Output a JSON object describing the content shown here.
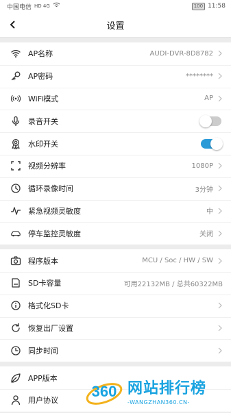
{
  "status_bar": {
    "carrier": "中国电信",
    "network": "HD 4G",
    "battery": "100",
    "time": "11:58"
  },
  "header": {
    "title": "设置"
  },
  "group1": [
    {
      "icon": "wifi-icon",
      "label": "AP名称",
      "value": "AUDI-DVR-8D8782",
      "chevron": true
    },
    {
      "icon": "key-icon",
      "label": "AP密码",
      "value": "********",
      "chevron": true
    },
    {
      "icon": "signal-icon",
      "label": "WiFi模式",
      "value": "AP",
      "chevron": true
    },
    {
      "icon": "microphone-icon",
      "label": "录音开关",
      "toggle": false
    },
    {
      "icon": "award-icon",
      "label": "水印开关",
      "toggle": true
    },
    {
      "icon": "frame-icon",
      "label": "视频分辨率",
      "value": "1080P",
      "chevron": true
    },
    {
      "icon": "clock-icon",
      "label": "循环录像时间",
      "value": "3分钟",
      "chevron": true
    },
    {
      "icon": "pulse-icon",
      "label": "紧急视频灵敏度",
      "value": "中",
      "chevron": true
    },
    {
      "icon": "car-icon",
      "label": "停车监控灵敏度",
      "value": "关闭",
      "chevron": true
    }
  ],
  "group2": [
    {
      "icon": "camera-icon",
      "label": "程序版本",
      "value": "MCU / Soc / HW / SW",
      "chevron": true
    },
    {
      "icon": "sd-card-icon",
      "label": "SD卡容量",
      "value": "可用22132MB / 总共60322MB",
      "chevron": false
    },
    {
      "icon": "info-icon",
      "label": "格式化SD卡",
      "chevron": true
    },
    {
      "icon": "reset-icon",
      "label": "恢复出厂设置",
      "chevron": true
    },
    {
      "icon": "sync-clock-icon",
      "label": "同步时间",
      "chevron": true
    }
  ],
  "group3": [
    {
      "icon": "leaf-icon",
      "label": "APP版本"
    },
    {
      "icon": "user-icon",
      "label": "用户协议"
    }
  ],
  "watermark": {
    "badge": "360",
    "title": "网站排行榜",
    "url": "-WANGZHAN360.CN-"
  },
  "colors": {
    "accent": "#2b9bd8",
    "watermark": "#19a3e0"
  }
}
